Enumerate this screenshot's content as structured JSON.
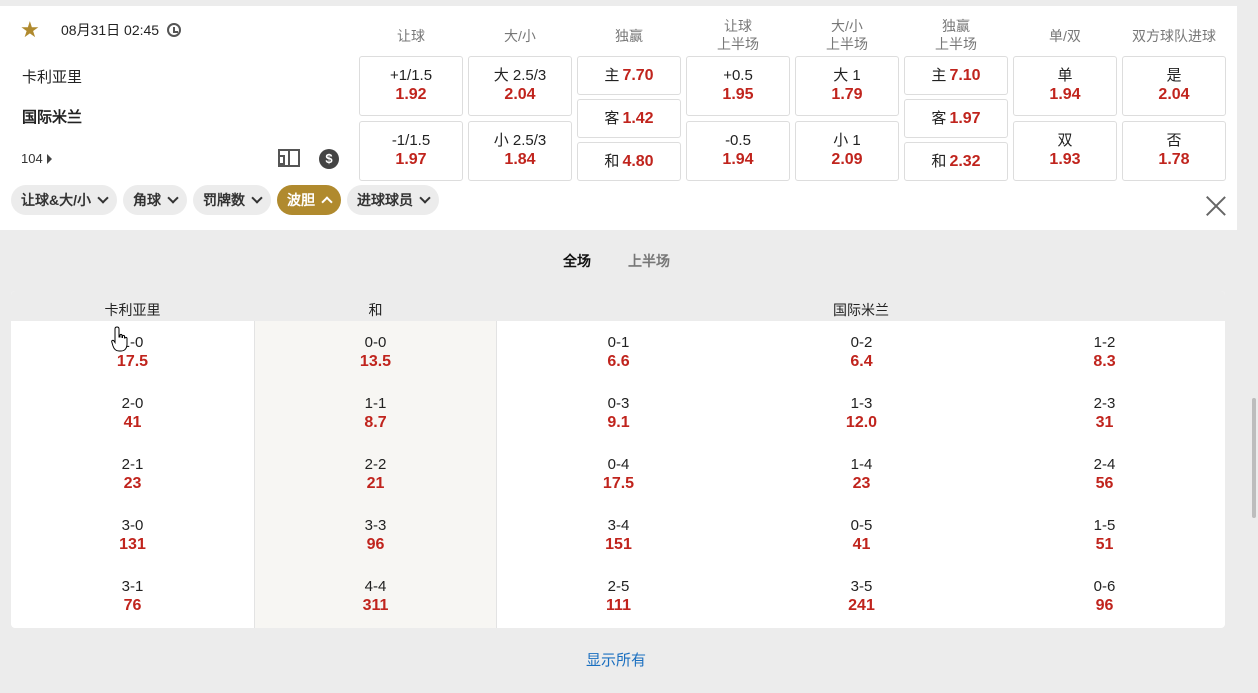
{
  "match": {
    "datetime": "08月31日 02:45",
    "home": "卡利亚里",
    "away": "国际米兰",
    "market_count": "104"
  },
  "headers": [
    {
      "l1": "让球",
      "l2": ""
    },
    {
      "l1": "大/小",
      "l2": ""
    },
    {
      "l1": "独赢",
      "l2": ""
    },
    {
      "l1": "让球",
      "l2": "上半场"
    },
    {
      "l1": "大/小",
      "l2": "上半场"
    },
    {
      "l1": "独赢",
      "l2": "上半场"
    },
    {
      "l1": "单/双",
      "l2": ""
    },
    {
      "l1": "双方球队进球",
      "l2": ""
    }
  ],
  "odds": {
    "hcp": [
      {
        "label": "+1/1.5",
        "odd": "1.92"
      },
      {
        "label": "-1/1.5",
        "odd": "1.97"
      }
    ],
    "ou": [
      {
        "label": "大 2.5/3",
        "odd": "2.04"
      },
      {
        "label": "小 2.5/3",
        "odd": "1.84"
      }
    ],
    "x12": [
      {
        "label": "主",
        "odd": "7.70"
      },
      {
        "label": "客",
        "odd": "1.42"
      },
      {
        "label": "和",
        "odd": "4.80"
      }
    ],
    "hcp_1h": [
      {
        "label": "+0.5",
        "odd": "1.95"
      },
      {
        "label": "-0.5",
        "odd": "1.94"
      }
    ],
    "ou_1h": [
      {
        "label": "大 1",
        "odd": "1.79"
      },
      {
        "label": "小 1",
        "odd": "2.09"
      }
    ],
    "x12_1h": [
      {
        "label": "主",
        "odd": "7.10"
      },
      {
        "label": "客",
        "odd": "1.97"
      },
      {
        "label": "和",
        "odd": "2.32"
      }
    ],
    "oe": [
      {
        "label": "单",
        "odd": "1.94"
      },
      {
        "label": "双",
        "odd": "1.93"
      }
    ],
    "btts": [
      {
        "label": "是",
        "odd": "2.04"
      },
      {
        "label": "否",
        "odd": "1.78"
      }
    ]
  },
  "tabs": [
    "让球&大/小",
    "角球",
    "罚牌数",
    "波胆",
    "进球球员"
  ],
  "active_tab": "波胆",
  "periods": [
    "全场",
    "上半场"
  ],
  "correct_score": {
    "headers": {
      "home": "卡利亚里",
      "draw": "和",
      "away": "国际米兰"
    },
    "columns": [
      [
        {
          "s": "1-0",
          "o": "17.5"
        },
        {
          "s": "2-0",
          "o": "41"
        },
        {
          "s": "2-1",
          "o": "23"
        },
        {
          "s": "3-0",
          "o": "131"
        },
        {
          "s": "3-1",
          "o": "76"
        }
      ],
      [
        {
          "s": "0-0",
          "o": "13.5"
        },
        {
          "s": "1-1",
          "o": "8.7"
        },
        {
          "s": "2-2",
          "o": "21"
        },
        {
          "s": "3-3",
          "o": "96"
        },
        {
          "s": "4-4",
          "o": "311"
        }
      ],
      [
        {
          "s": "0-1",
          "o": "6.6"
        },
        {
          "s": "0-3",
          "o": "9.1"
        },
        {
          "s": "0-4",
          "o": "17.5"
        },
        {
          "s": "3-4",
          "o": "151"
        },
        {
          "s": "2-5",
          "o": "111"
        }
      ],
      [
        {
          "s": "0-2",
          "o": "6.4"
        },
        {
          "s": "1-3",
          "o": "12.0"
        },
        {
          "s": "1-4",
          "o": "23"
        },
        {
          "s": "0-5",
          "o": "41"
        },
        {
          "s": "3-5",
          "o": "241"
        }
      ],
      [
        {
          "s": "1-2",
          "o": "8.3"
        },
        {
          "s": "2-3",
          "o": "31"
        },
        {
          "s": "2-4",
          "o": "56"
        },
        {
          "s": "1-5",
          "o": "51"
        },
        {
          "s": "0-6",
          "o": "96"
        }
      ]
    ]
  },
  "show_all": "显示所有",
  "colors": {
    "accent": "#b08a2e",
    "odds_red": "#c0241d",
    "link_blue": "#1a6fc0"
  }
}
